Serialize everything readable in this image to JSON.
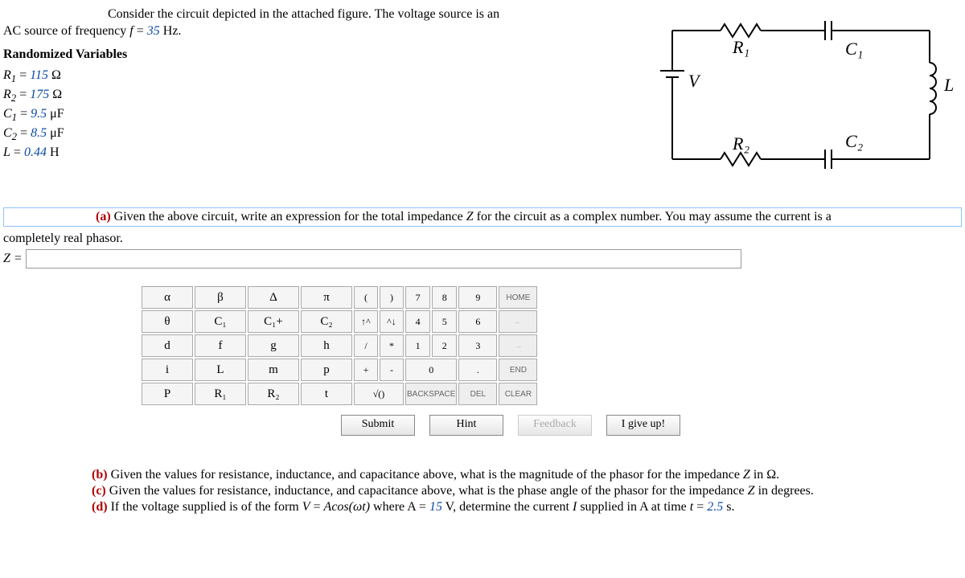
{
  "intro": {
    "line1_a": "Consider the circuit depicted in the attached figure. The voltage source is an",
    "line1_b": "AC source of frequency ",
    "freq_var": "f",
    "eq": " = ",
    "freq_val": "35",
    "freq_unit": " Hz."
  },
  "rand_heading": "Randomized Variables",
  "vars": {
    "R1": {
      "sym": "R",
      "sub": "1",
      "eq": " = ",
      "val": "115",
      "unit": " Ω"
    },
    "R2": {
      "sym": "R",
      "sub": "2",
      "eq": " = ",
      "val": "175",
      "unit": " Ω"
    },
    "C1": {
      "sym": "C",
      "sub": "1",
      "eq": " = ",
      "val": "9.5",
      "unit": " μF"
    },
    "C2": {
      "sym": "C",
      "sub": "2",
      "eq": " = ",
      "val": "8.5",
      "unit": " μF"
    },
    "L": {
      "sym": "L",
      "sub": "",
      "eq": " = ",
      "val": "0.44",
      "unit": " H"
    }
  },
  "circuit_labels": {
    "V": "V",
    "R1": "R₁",
    "R2": "R₂",
    "C1": "C₁",
    "C2": "C₂",
    "L": "L"
  },
  "part_a": {
    "label": "(a)",
    "text_before": "  Given the above circuit, write an expression for the total impedance ",
    "Z": "Z",
    "text_mid": " for the circuit as a complex number. You may assume the current is a",
    "line2": "completely real phasor."
  },
  "answer": {
    "lhs": "Z = ",
    "value": ""
  },
  "keypad": {
    "r1": [
      "α",
      "β",
      "Δ",
      "π"
    ],
    "r2": [
      "θ",
      "C₁",
      "C₁+",
      "C₂"
    ],
    "r3": [
      "d",
      "f",
      "g",
      "h"
    ],
    "r4": [
      "i",
      "L",
      "m",
      "p"
    ],
    "r5": [
      "P",
      "R₁",
      "R₂",
      "t"
    ],
    "paren_open": "(",
    "paren_close": ")",
    "n7": "7",
    "n8": "8",
    "n9": "9",
    "up": "↑^",
    "down": "^↓",
    "n4": "4",
    "n5": "5",
    "n6": "6",
    "slash": "/",
    "star": "*",
    "n1": "1",
    "n2": "2",
    "n3": "3",
    "plus": "+",
    "minus": "-",
    "n0": "0",
    "dot": ".",
    "sqrt": "√()",
    "backspace": "BACKSPACE",
    "del": "DEL",
    "home": "HOME",
    "left": "←",
    "right": "→",
    "end": "END",
    "clear": "CLEAR"
  },
  "actions": {
    "submit": "Submit",
    "hint": "Hint",
    "feedback": "Feedback",
    "giveup": "I give up!"
  },
  "part_b": {
    "label": "(b)",
    "text": "  Given the values for resistance, inductance, and capacitance above, what is the magnitude of the phasor for the impedance ",
    "Z": "Z",
    "tail": " in Ω."
  },
  "part_c": {
    "label": "(c)",
    "text": "  Given the values for resistance, inductance, and capacitance above, what is the phase angle of the phasor for the impedance ",
    "Z": "Z",
    "tail": " in degrees."
  },
  "part_d": {
    "label": "(d)",
    "lead": "  If the voltage supplied is of the form ",
    "V": "V",
    "eq1": " = ",
    "form": "Acos(ωt)",
    "where": " where A = ",
    "A_val": "15",
    "mid": " V, determine the current ",
    "I": "I",
    "mid2": " supplied in A at time ",
    "tvar": "t",
    "eq2": " = ",
    "t_val": "2.5",
    "tail": " s."
  }
}
